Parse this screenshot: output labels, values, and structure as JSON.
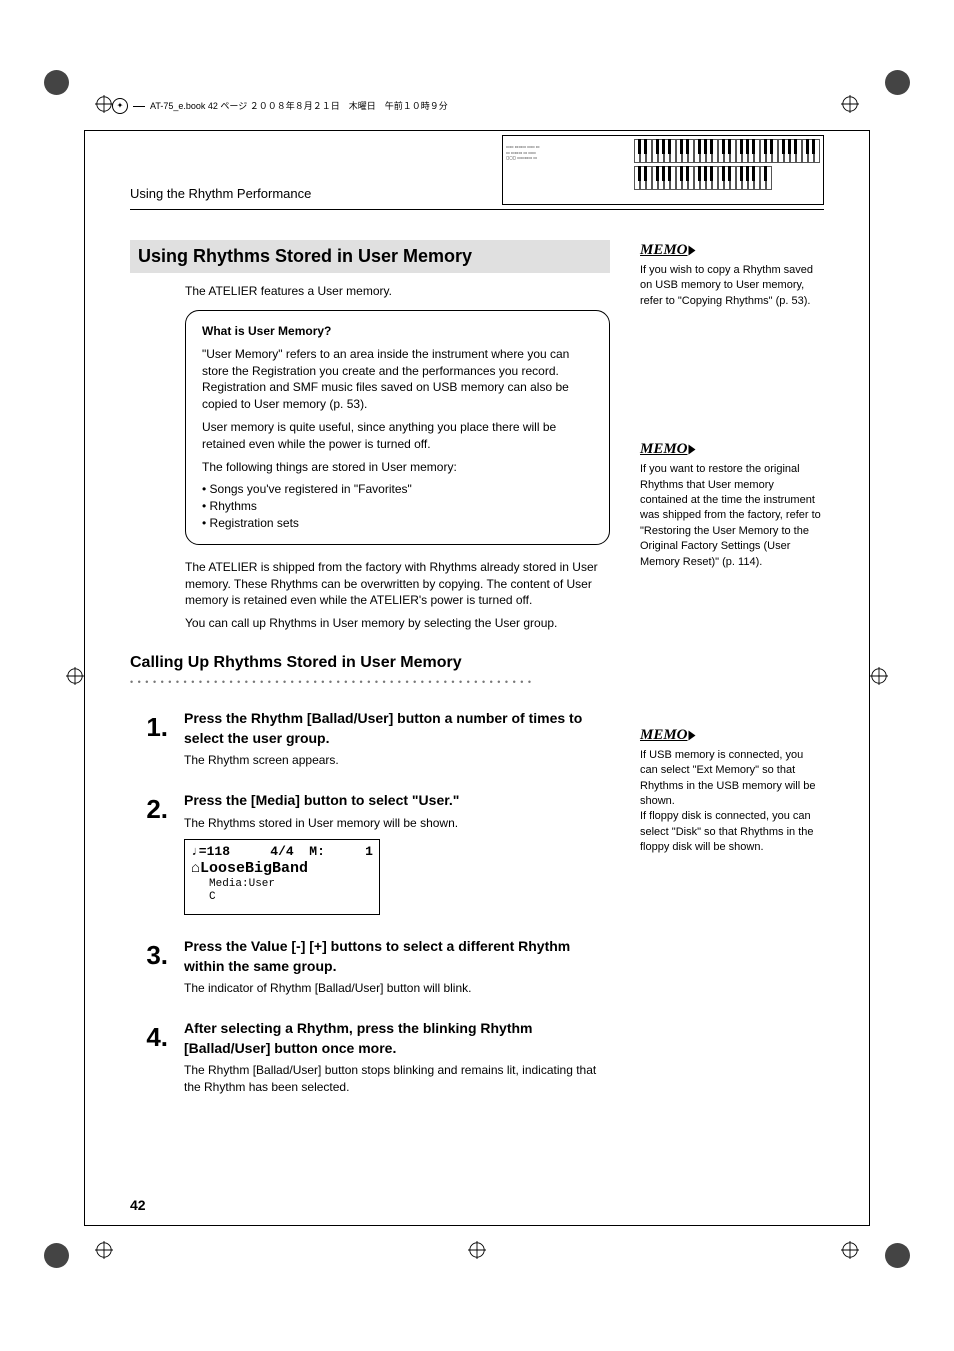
{
  "tag": "AT-75_e.book 42 ページ ２００８年８月２１日　木曜日　午前１０時９分",
  "breadcrumb": "Using the Rhythm Performance",
  "h1": "Using Rhythms Stored in User Memory",
  "intro": "The ATELIER features a User memory.",
  "box": {
    "title": "What is User Memory?",
    "p1": "\"User Memory\" refers to an area inside the instrument where you can store the Registration you create and the performances you record. Registration and SMF music files saved on USB memory can also be copied to User memory (p. 53).",
    "p2": "User memory is quite useful, since anything you place there will be retained even while the power is turned off.",
    "p3": "The following things are stored in User memory:",
    "items": [
      "• Songs you've registered in \"Favorites\"",
      "• Rhythms",
      "• Registration sets"
    ]
  },
  "para1": "The ATELIER is shipped from the factory with Rhythms already stored in User memory. These Rhythms can be overwritten by copying. The content of User memory is retained even while the ATELIER's power is turned off.",
  "para2": "You can call up Rhythms in User memory by selecting the User group.",
  "h2": "Calling Up Rhythms Stored in User Memory",
  "steps": [
    {
      "num": "1.",
      "title": "Press the Rhythm [Ballad/User] button a number of times to select the user group.",
      "desc": "The Rhythm screen appears."
    },
    {
      "num": "2.",
      "title": "Press the [Media] button to select \"User.\"",
      "desc": "The Rhythms stored in User memory will be shown."
    },
    {
      "num": "3.",
      "title": "Press the Value [-] [+] buttons to select a different Rhythm within the same group.",
      "desc": "The indicator of Rhythm [Ballad/User] button will blink."
    },
    {
      "num": "4.",
      "title": "After selecting a Rhythm, press the blinking Rhythm [Ballad/User] button once more.",
      "desc": "The Rhythm [Ballad/User] button stops blinking and remains lit, indicating that the Rhythm has been selected."
    }
  ],
  "lcd": {
    "tempo": "♩=118",
    "sig": "4/4",
    "m": "M:",
    "mval": "1",
    "name": "⌂LooseBigBand",
    "media": "Media:User",
    "cat": "C"
  },
  "memos": [
    {
      "label": "MEMO",
      "text": "If you wish to copy a Rhythm saved on USB memory to User memory, refer to \"Copying Rhythms\" (p. 53)."
    },
    {
      "label": "MEMO",
      "text": "If you want to restore the original Rhythms that User memory contained at the time the instrument was shipped from the factory, refer to \"Restoring the User Memory to the Original Factory Settings (User Memory Reset)\" (p. 114)."
    },
    {
      "label": "MEMO",
      "text": "If USB memory is connected, you can select \"Ext Memory\" so that Rhythms in the USB memory will be shown.\nIf floppy disk is connected, you can select \"Disk\" so that Rhythms in the floppy disk will be shown."
    }
  ],
  "page_num": "42"
}
